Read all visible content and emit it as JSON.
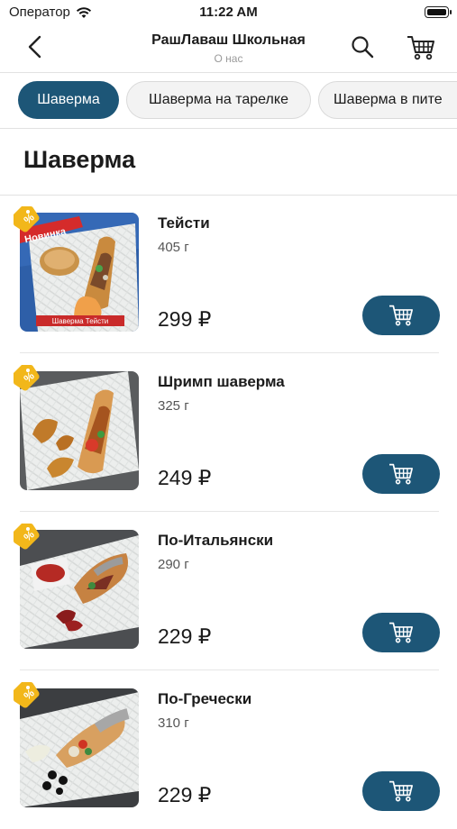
{
  "status_bar": {
    "carrier": "Оператор",
    "time": "11:22 AM"
  },
  "header": {
    "title": "РашЛаваш Школьная",
    "subtitle": "О нас",
    "back_icon": "chevron-left-icon",
    "search_icon": "search-icon",
    "cart_icon": "cart-icon"
  },
  "categories": [
    {
      "label": "Шаверма",
      "active": true
    },
    {
      "label": "Шаверма на тарелке",
      "active": false
    },
    {
      "label": "Шаверма в пите",
      "active": false
    }
  ],
  "section": {
    "title": "Шаверма"
  },
  "products": [
    {
      "name": "Тейсти",
      "weight": "405 г",
      "price": "299 ₽",
      "photo_label_top": "Новинка",
      "photo_label_bottom": "Шаверма Тейсти"
    },
    {
      "name": "Шримп шаверма",
      "weight": "325 г",
      "price": "249 ₽"
    },
    {
      "name": "По-Итальянски",
      "weight": "290 г",
      "price": "229 ₽"
    },
    {
      "name": "По-Гречески",
      "weight": "310 г",
      "price": "229 ₽"
    }
  ],
  "colors": {
    "accent": "#1d5677",
    "badge": "#f2b71a"
  }
}
